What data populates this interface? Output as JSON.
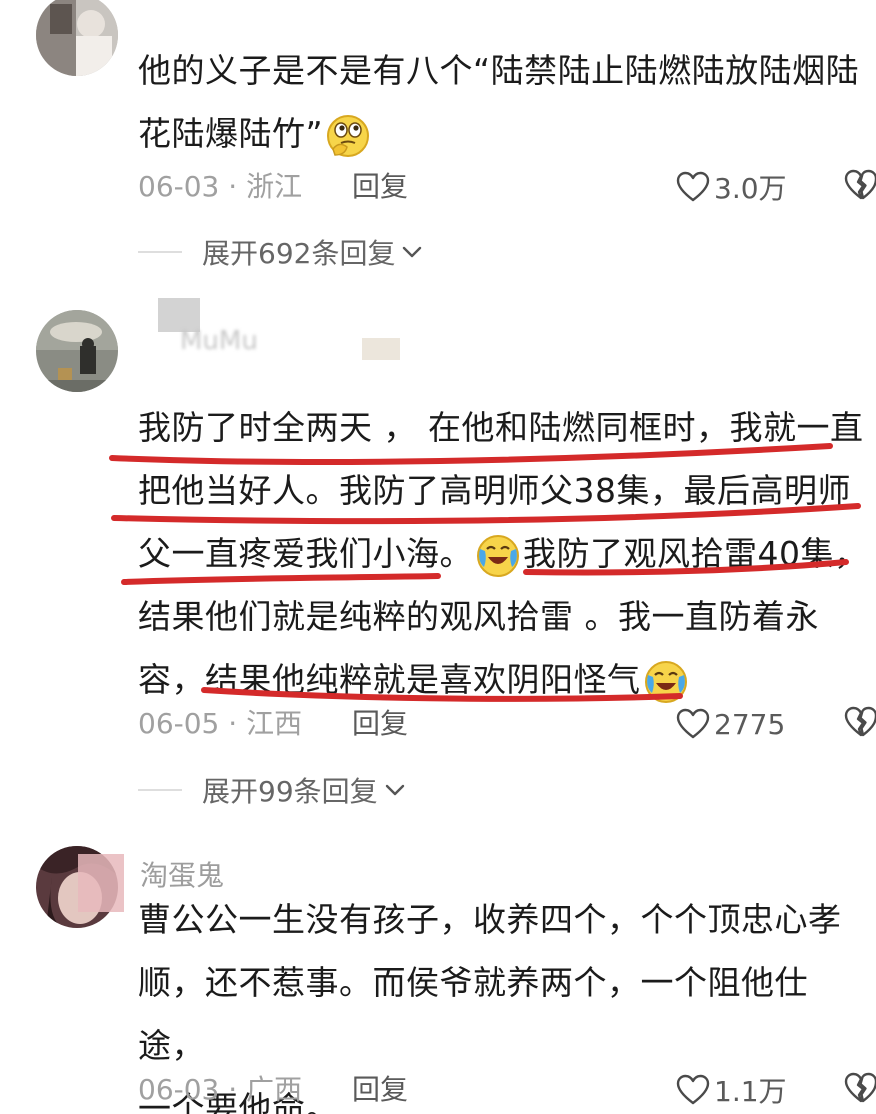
{
  "comments": [
    {
      "text_lines": [
        "他的义子是不是有八个“陆禁陆止陆燃陆放陆烟陆",
        "花陆爆陆竹”"
      ],
      "date_location": "06-03 · 浙江",
      "reply_label": "回复",
      "likes": "3.0万",
      "expand_label": "展开692条回复",
      "emoji": "thinking-emoji"
    },
    {
      "username": "MuMu",
      "text_lines": [
        "我防了时全两天 ， 在他和陆燃同框时，我就一直",
        "把他当好人。我防了高明师父38集，最后高明师",
        "父一直疼爱我们小海。",
        "我防了观风拾雷40集，",
        "结果他们就是纯粹的观风拾雷 。我一直防着永",
        "容，",
        "结果他纯粹就是喜欢阴阳怪气"
      ],
      "date_location": "06-05 · 江西",
      "reply_label": "回复",
      "likes": "2775",
      "expand_label": "展开99条回复",
      "emoji": "crying-laughing-emoji",
      "underline_color": "#d42a2a"
    },
    {
      "username": "淘蛋鬼",
      "text_lines": [
        "曹公公一生没有孩子，收养四个，个个顶忠心孝",
        "顺，还不惹事。而侯爷就养两个，一个阻他仕途，",
        "一个要他命。"
      ],
      "date_location": "06-03 · 广西",
      "reply_label": "回复",
      "likes": "1.1万"
    }
  ],
  "icons": {
    "like": "heart-outline-icon",
    "dislike": "broken-heart-icon",
    "expand": "chevron-down-icon"
  },
  "colors": {
    "text": "#1b1b1b",
    "meta": "#a0a0a0",
    "underline": "#d42a2a"
  }
}
